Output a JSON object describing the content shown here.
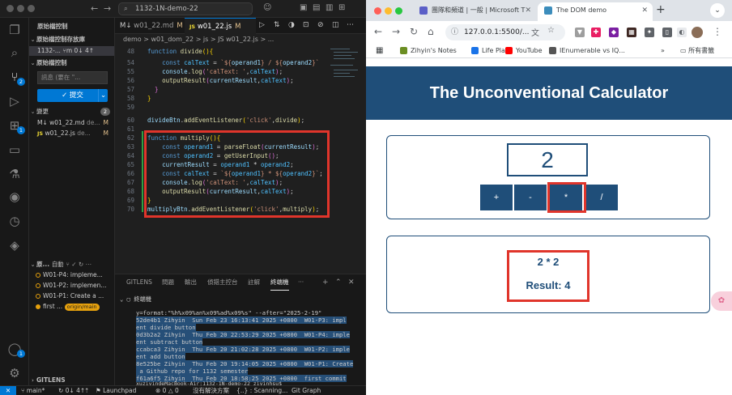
{
  "vscode": {
    "search": "1132-1N-demo-22",
    "sidebar": {
      "title": "原始檔控制",
      "repos_header": "原始檔控制存放庫",
      "repo_name": "1132-...",
      "repo_branch": "m",
      "repo_sync": "0↓ 4↑",
      "section_title": "原始檔控制",
      "commit_placeholder": "訊息 (要在 \"...",
      "commit_button": "✓ 提交",
      "changes_label": "變更",
      "changes_count": "2",
      "files": [
        {
          "name": "w01_22.md",
          "path": "de...",
          "status": "M",
          "icon": "markdown-icon"
        },
        {
          "name": "w01_22.js",
          "path": "de...",
          "status": "M",
          "icon": "js-icon"
        }
      ],
      "graph_header": "原...",
      "graph_auto": "自動",
      "graph_items": [
        "W01-P4: impleme...",
        "W01-P2: implemen...",
        "W01-P1: Create a ...",
        "first ..."
      ],
      "graph_branch_tag": "origin/main",
      "gitlens_label": "GITLENS"
    },
    "tabs": [
      {
        "label": "w01_22.md",
        "status": "M",
        "active": false
      },
      {
        "label": "w01_22.js",
        "status": "M",
        "active": true
      }
    ],
    "breadcrumb": "demo > w01_dom_22 > js > JS w01_22.js > ...",
    "line_numbers": [
      "48",
      "54",
      "55",
      "56",
      "57",
      "58",
      "59",
      "60",
      "61",
      "62",
      "63",
      "64",
      "65",
      "66",
      "67",
      "68",
      "69",
      "70"
    ],
    "panel_tabs": [
      "GITLENS",
      "問題",
      "輸出",
      "偵錯主控台",
      "註解",
      "終端機",
      "···"
    ],
    "terminal_header": "終端機",
    "terminal_lines": [
      "y=format:\"%h%x09%an%x09%ad%x09%s\" --after=\"2025-2-19\"",
      "52de4b1 Zihyin  Sun Feb 23 16:13:41 2025 +0800  W01-P3: impl",
      "ent divide button",
      "0d3b2a2 Zihyin  Thu Feb 20 22:53:29 2025 +0800  W01-P4: imple",
      "ent subtract button",
      "ccabca3 Zihyin  Thu Feb 20 21:02:28 2025 +0800  W01-P2: imple",
      "ent add button",
      "8e525be Zihyin  Thu Feb 20 19:14:05 2025 +0800  W01-P1: Create",
      " a Github repo for 1132 semester",
      "f61a6f5 Zihyin  Thu Feb 20 18:58:25 2025 +0800  first commit",
      "xuziyindeMacBook-Air:1132-1N-demo-22 ziyinhsu$ "
    ],
    "status": {
      "branch": "main*",
      "sync": "0↓ 4↑",
      "launchpad": "Launchpad",
      "problems": "⊗ 0 △ 0",
      "no_issues": "沒有解決方案",
      "scanning": "{..} : Scanning...",
      "git_graph": "Git Graph"
    }
  },
  "chrome": {
    "tabs": [
      {
        "title": "團隊和頻道 | 一般 | Microsoft T",
        "active": false,
        "fav_color": "#5b5fc7"
      },
      {
        "title": "The DOM demo",
        "active": true,
        "fav_color": "#3c8dbc"
      }
    ],
    "url": "127.0.0.1:5500/...",
    "bookmarks": [
      {
        "label": "Zihyin's Notes",
        "color": "#6b8e23"
      },
      {
        "label": "Life Plan",
        "color": "#1a73e8"
      },
      {
        "label": "YouTube",
        "color": "#ff0000"
      },
      {
        "label": "IEnumerable vs IQ...",
        "color": "#555555"
      }
    ],
    "bookmarks_more": "»",
    "bookmarks_all": "所有書籤",
    "page": {
      "title": "The Unconventional Calculator",
      "display": "2",
      "ops": [
        "+",
        "-",
        "*",
        "/"
      ],
      "result_expr": "2 * 2",
      "result_text": "Result: 4"
    }
  },
  "colors": {
    "calc_primary": "#1f4e79",
    "highlight": "#e0352b",
    "vscode_accent": "#0078d4"
  }
}
